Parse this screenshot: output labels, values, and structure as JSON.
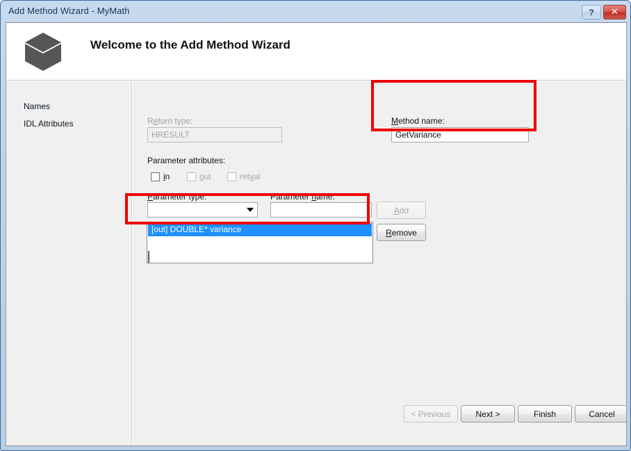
{
  "window": {
    "title": "Add Method Wizard - MyMath",
    "help_button": "?",
    "close_button": "✕",
    "help_icon_name": "help-icon",
    "close_icon_name": "close-icon",
    "frame_color": "#3c6898",
    "titlebar_color": "#c1d5ec",
    "close_button_color": "#bc2c24"
  },
  "banner": {
    "title": "Welcome to the Add Method Wizard",
    "icon": "cube-icon",
    "icon_color": "#565656"
  },
  "sidebar": {
    "items": [
      {
        "label": "Names",
        "selected": true
      },
      {
        "label": "IDL Attributes",
        "selected": false
      }
    ]
  },
  "main": {
    "return_type": {
      "label_pre": "R",
      "label_acc": "e",
      "label_post": "turn type:",
      "value": "HRESULT",
      "enabled": false
    },
    "method_name": {
      "label_acc": "M",
      "label_post": "ethod name:",
      "value": "GetVariance",
      "enabled": true
    },
    "parameter_attributes": {
      "label": "Parameter attributes:",
      "checkboxes": [
        {
          "pre": "",
          "acc": "i",
          "post": "n",
          "checked": false,
          "enabled": true
        },
        {
          "pre": "",
          "acc": "o",
          "post": "ut",
          "checked": false,
          "enabled": false
        },
        {
          "pre": "ret",
          "acc": "v",
          "post": "al",
          "checked": false,
          "enabled": false
        }
      ]
    },
    "parameter_type": {
      "label_acc": "P",
      "label_post": "arameter type:",
      "value": "",
      "arrow_icon": "chevron-down-icon"
    },
    "parameter_name": {
      "label_pre": "Parameter ",
      "label_acc": "n",
      "label_post": "ame:",
      "value": ""
    },
    "add_button": {
      "pre": "",
      "acc": "A",
      "post": "dd",
      "enabled": false
    },
    "remove_button": {
      "pre": "",
      "acc": "R",
      "post": "emove",
      "enabled": true
    },
    "parameter_list": {
      "items": [
        {
          "label": "[out] DOUBLE* variance",
          "selected": true
        }
      ],
      "selection_color": "#1e90ff"
    }
  },
  "footer": {
    "buttons": [
      {
        "label": "< Previous",
        "enabled": false
      },
      {
        "label": "Next >",
        "enabled": true
      },
      {
        "label": "Finish",
        "enabled": true
      },
      {
        "label": "Cancel",
        "enabled": true
      }
    ]
  },
  "annotations": {
    "color": "#ee0000",
    "boxes": [
      {
        "name": "method-name-highlight"
      },
      {
        "name": "parameter-list-highlight"
      }
    ]
  }
}
